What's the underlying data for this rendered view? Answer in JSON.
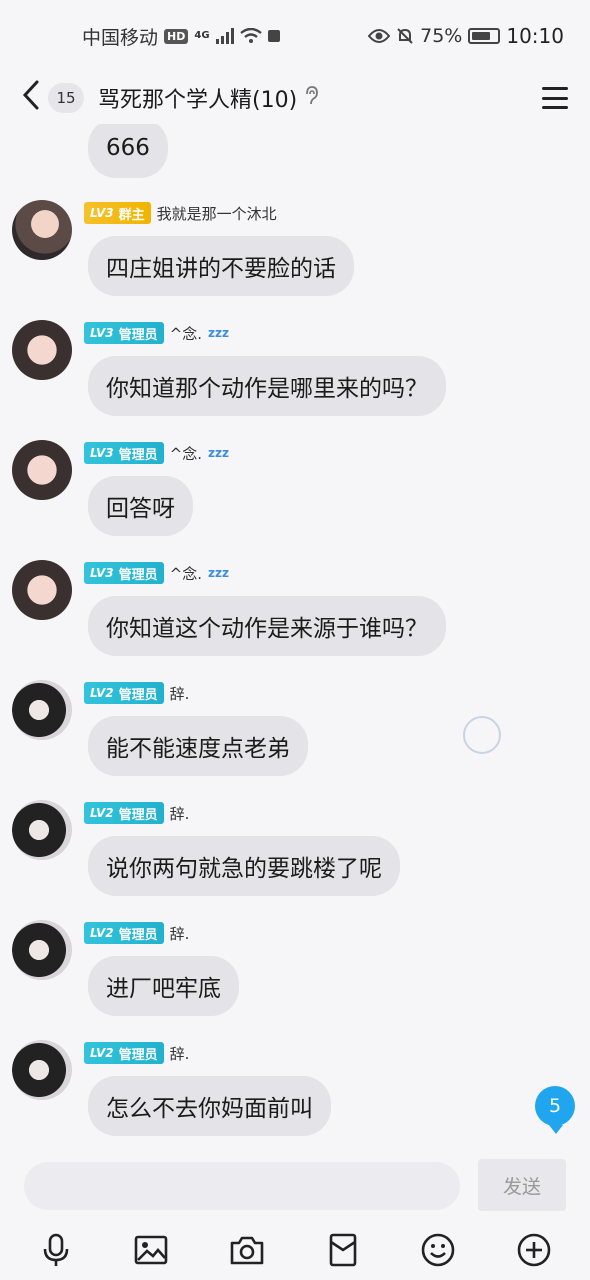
{
  "status_bar": {
    "carrier": "中国移动",
    "hd": "HD",
    "network": "4G",
    "battery": "75%",
    "time": "10:10"
  },
  "header": {
    "unread_count": "15",
    "title": "骂死那个学人精(10)"
  },
  "messages": [
    {
      "id": "m0",
      "text": "666"
    },
    {
      "id": "m1",
      "level": "LV3",
      "role": "群主",
      "nickname": "我就是那一个沐北",
      "text": "四庄姐讲的不要脸的话"
    },
    {
      "id": "m2",
      "level": "LV3",
      "role": "管理员",
      "nickname": "^念.",
      "text": "你知道那个动作是哪里来的吗？"
    },
    {
      "id": "m3",
      "level": "LV3",
      "role": "管理员",
      "nickname": "^念.",
      "text": "回答呀"
    },
    {
      "id": "m4",
      "level": "LV3",
      "role": "管理员",
      "nickname": "^念.",
      "text": "你知道这个动作是来源于谁吗？"
    },
    {
      "id": "m5",
      "level": "LV2",
      "role": "管理员",
      "nickname": "辞.",
      "text": "能不能速度点老弟"
    },
    {
      "id": "m6",
      "level": "LV2",
      "role": "管理员",
      "nickname": "辞.",
      "text": "说你两句就急的要跳楼了呢"
    },
    {
      "id": "m7",
      "level": "LV2",
      "role": "管理员",
      "nickname": "辞.",
      "text": "进厂吧牢底"
    },
    {
      "id": "m8",
      "level": "LV2",
      "role": "管理员",
      "nickname": "辞.",
      "text": "怎么不去你妈面前叫"
    }
  ],
  "new_message_count": "5",
  "input": {
    "value": "",
    "send_label": "发送"
  },
  "toolbar": [
    "mic-icon",
    "image-icon",
    "camera-icon",
    "red-packet-icon",
    "emoji-icon",
    "plus-icon"
  ],
  "colors": {
    "owner_badge": "#f6c12a",
    "admin_badge": "#21b1ce",
    "unread_badge": "#1fa6ef",
    "bubble": "#e4e4e8"
  }
}
